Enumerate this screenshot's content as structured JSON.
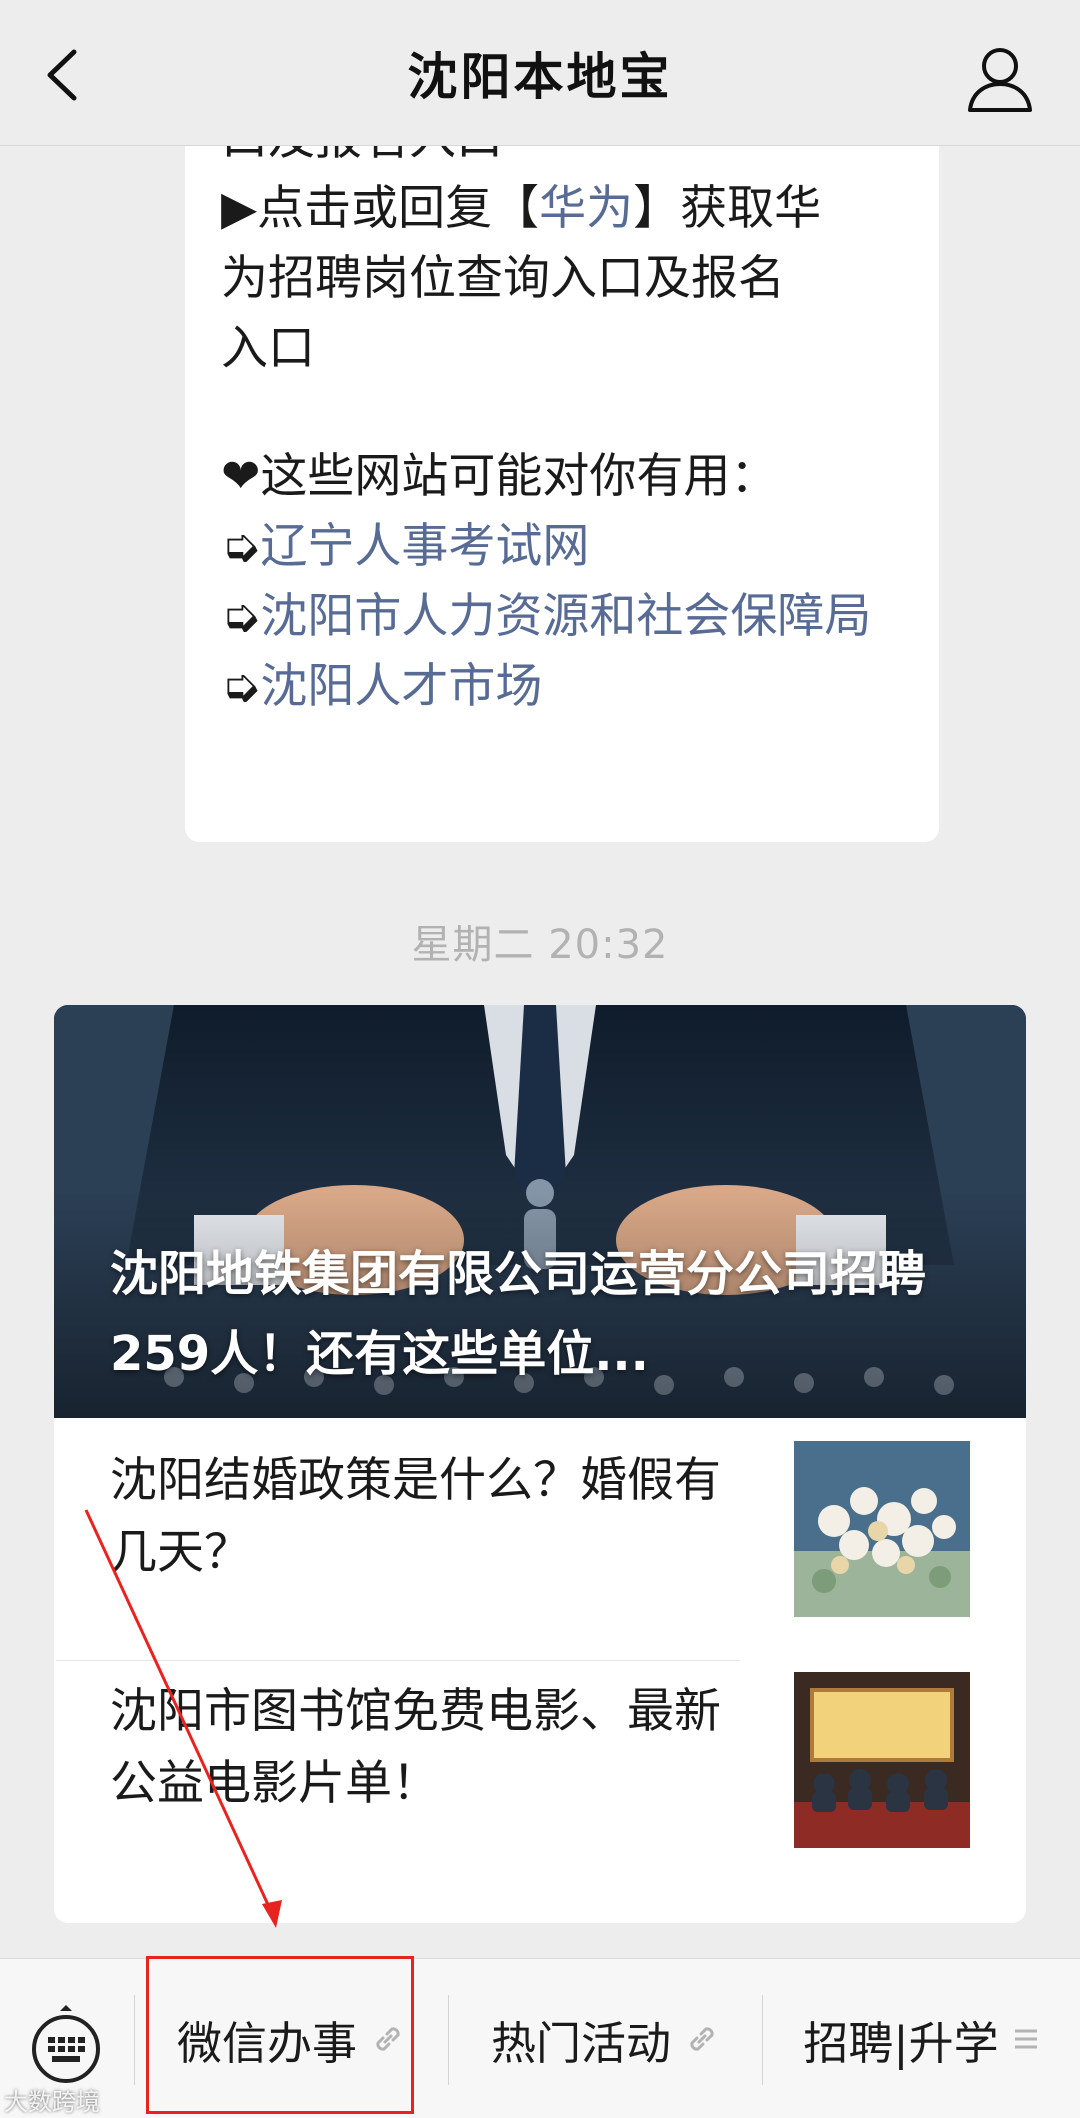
{
  "header": {
    "title": "沈阳本地宝"
  },
  "message": {
    "line1": "口及报名入口",
    "line2_prefix": "▶点击或回复【",
    "line2_link": "华为",
    "line2_suffix": "】获取华",
    "line3": "为招聘岗位查询入口及报名",
    "line4": "入口",
    "useful_heading": "❤这些网站可能对你有用：",
    "links": [
      "辽宁人事考试网",
      "沈阳市人力资源和社会保障局",
      "沈阳人才市场"
    ],
    "arrow_glyph": "➭"
  },
  "timestamp": "星期二 20:32",
  "article": {
    "cover_title": "沈阳地铁集团有限公司运营分公司招聘259人！还有这些单位...",
    "items": [
      {
        "title": "沈阳结婚政策是什么？婚假有几天？",
        "thumb": "flowers-image"
      },
      {
        "title": "沈阳市图书馆免费电影、最新公益电影片单！",
        "thumb": "cinema-image"
      }
    ]
  },
  "bottom_menu": {
    "items": [
      {
        "label": "微信办事",
        "icon": "link-icon"
      },
      {
        "label": "热门活动",
        "icon": "link-icon"
      },
      {
        "label": "招聘|升学",
        "icon": "menu-icon"
      }
    ]
  },
  "watermark": "大数跨境",
  "colors": {
    "link": "#576b95",
    "annotation": "#e8231f",
    "background": "#ededed"
  }
}
